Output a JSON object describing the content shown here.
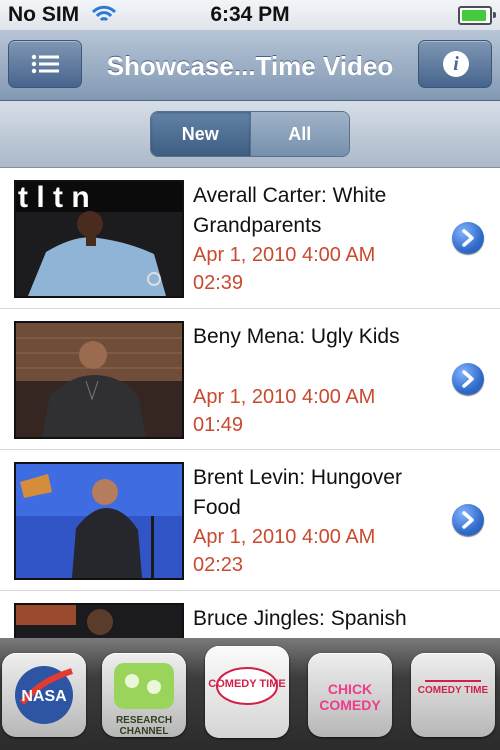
{
  "status_bar": {
    "carrier": "No SIM",
    "time": "6:34 PM",
    "battery_level": 1.0,
    "wifi_icon": "wifi-icon"
  },
  "nav": {
    "title": "Showcase...Time Video",
    "left_button_icon": "menu-icon",
    "right_button_icon": "info-icon",
    "accent": "#5d7799"
  },
  "segmented_control": {
    "selected": "New",
    "options": [
      "New",
      "All"
    ]
  },
  "videos": [
    {
      "title": "Averall Carter: White Grandparents",
      "date": "Apr 1, 2010 4:00 AM",
      "duration": "02:39"
    },
    {
      "title": "Beny Mena: Ugly Kids",
      "date": "Apr 1, 2010 4:00 AM",
      "duration": "01:49"
    },
    {
      "title": "Brent Levin: Hungover Food",
      "date": "Apr 1, 2010 4:00 AM",
      "duration": "02:23"
    },
    {
      "title": "Bruce Jingles: Spanish",
      "date": "",
      "duration": ""
    }
  ],
  "tabs": [
    {
      "name": "NASA",
      "icon": "nasa-logo-icon"
    },
    {
      "name": "RESEARCH CHANNEL",
      "icon": "research-channel-icon"
    },
    {
      "name": "COMEDY TIME",
      "icon": "comedy-time-icon"
    },
    {
      "name": "CHICK COMEDY",
      "icon": "chick-comedy-icon"
    },
    {
      "name": "COMEDY TIME",
      "icon": "comedy-time-icon-alt"
    }
  ],
  "colors": {
    "date_text": "#c94a2e",
    "disclosure": "#2f6ac9",
    "navbar": "#8ea3bd"
  }
}
